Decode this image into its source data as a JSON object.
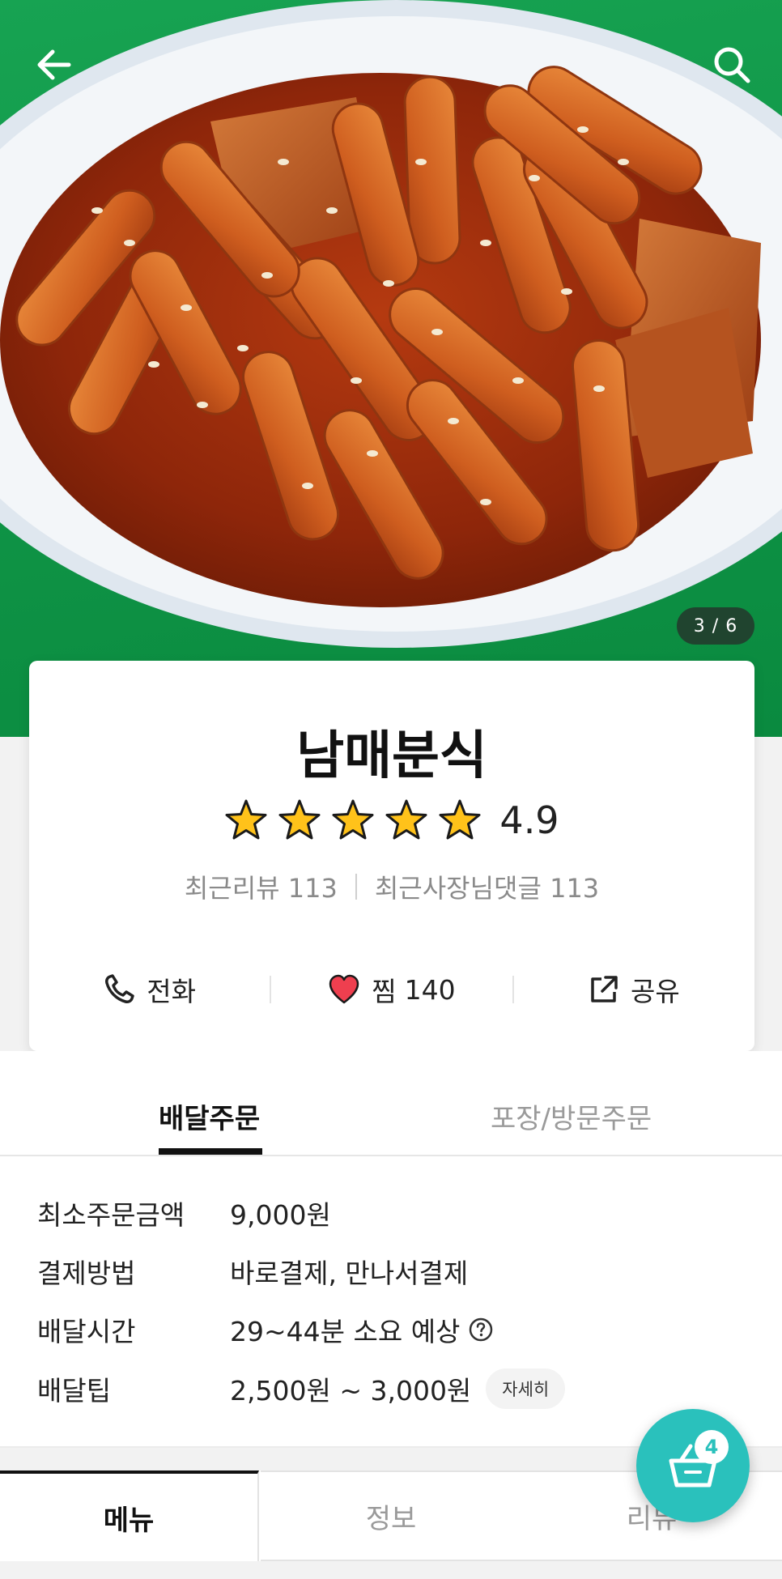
{
  "hero": {
    "photo_counter": "3 / 6",
    "background_color": "#0f9446",
    "back_icon": "arrow-left-icon",
    "search_icon": "search-icon"
  },
  "store": {
    "name": "남매분식",
    "rating": "4.9",
    "star_count": 5,
    "recent_reviews": "최근리뷰 113",
    "recent_owner_comments": "최근사장님댓글 113"
  },
  "actions": {
    "call_label": "전화",
    "favorite_label": "찜",
    "favorite_count": "140",
    "share_label": "공유"
  },
  "order_tabs": {
    "delivery_label": "배달주문",
    "pickup_label": "포장/방문주문",
    "active": "배달주문"
  },
  "order_info": {
    "min_order_label": "최소주문금액",
    "min_order_value": "9,000원",
    "payment_label": "결제방법",
    "payment_value": "바로결제, 만나서결제",
    "delivery_time_label": "배달시간",
    "delivery_time_value": "29~44분 소요 예상",
    "delivery_tip_label": "배달팁",
    "delivery_tip_value": "2,500원 ~ 3,000원",
    "detail_chip": "자세히"
  },
  "bottom_tabs": {
    "menu": "메뉴",
    "info": "정보",
    "review": "리뷰"
  },
  "cart": {
    "count": "4",
    "accent_color": "#2ac1bc"
  }
}
